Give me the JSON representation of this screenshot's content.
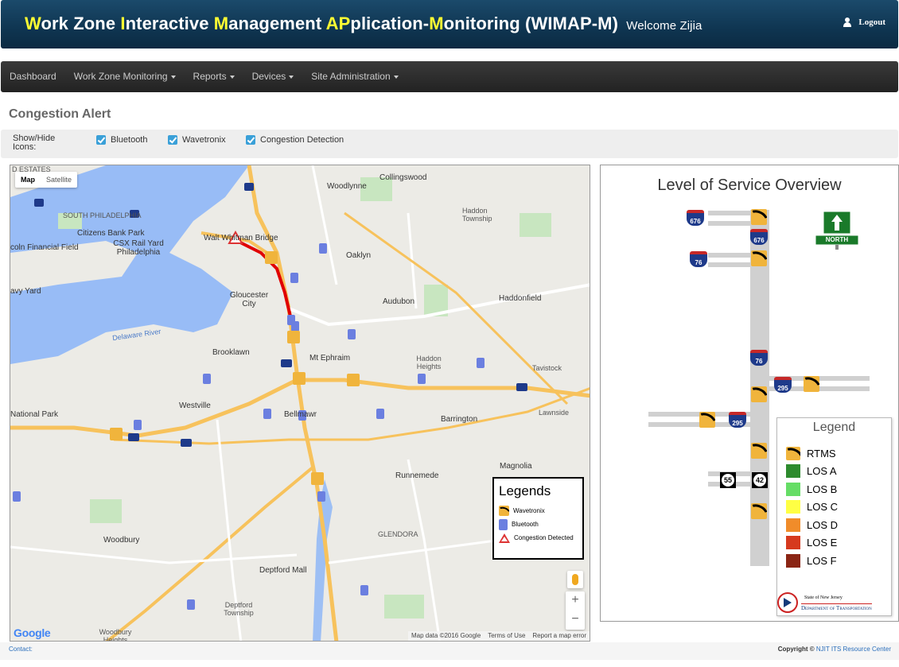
{
  "header": {
    "title_parts": [
      {
        "text": "W",
        "hl": true
      },
      {
        "text": "ork Zone ",
        "hl": false
      },
      {
        "text": "I",
        "hl": true
      },
      {
        "text": "nteractive ",
        "hl": false
      },
      {
        "text": "M",
        "hl": true
      },
      {
        "text": "anagement ",
        "hl": false
      },
      {
        "text": "AP",
        "hl": true
      },
      {
        "text": "plication-",
        "hl": false
      },
      {
        "text": "M",
        "hl": true
      },
      {
        "text": "onitoring (WIMAP-M)",
        "hl": false
      }
    ],
    "welcome": "Welcome Zijia",
    "logout_label": "Logout"
  },
  "nav": {
    "items": [
      {
        "label": "Dashboard",
        "dropdown": false
      },
      {
        "label": "Work Zone Monitoring",
        "dropdown": true
      },
      {
        "label": "Reports",
        "dropdown": true
      },
      {
        "label": "Devices",
        "dropdown": true
      },
      {
        "label": "Site Administration",
        "dropdown": true
      }
    ]
  },
  "page": {
    "title": "Congestion Alert",
    "show_hide_label": "Show/Hide Icons:",
    "checkboxes": [
      {
        "label": "Bluetooth",
        "checked": true
      },
      {
        "label": "Wavetronix",
        "checked": true
      },
      {
        "label": "Congestion Detection",
        "checked": true
      }
    ]
  },
  "map": {
    "type_buttons": {
      "map": "Map",
      "satellite": "Satellite"
    },
    "labels": [
      "D ESTATES",
      "Collingswood",
      "Woodlynne",
      "Haddon Township",
      "SOUTH PHILADELPHIA",
      "Citizens Bank Park",
      "CSX Rail Yard Philadelphia",
      "Walt Whitman Bridge",
      "coln Financial Field",
      "Oaklyn",
      "Gloucester City",
      "Audubon",
      "Haddonfield",
      "avy Yard",
      "Delaware River",
      "Brooklawn",
      "Mt Ephraim",
      "Haddon Heights",
      "Tavistock",
      "Westville",
      "Bellmawr",
      "Barrington",
      "Lawnside",
      "National Park",
      "Magnolia",
      "Runnemede",
      "GLENDORA",
      "Woodbury",
      "Deptford Mall",
      "Deptford Township",
      "Woodbury Heights"
    ],
    "legend": {
      "title": "Legends",
      "items": [
        "Wavetronix",
        "Bluetooth",
        "Congestion Detected"
      ]
    },
    "google": "Google",
    "footer": [
      "Map data ©2016 Google",
      "Terms of Use",
      "Report a map error"
    ]
  },
  "los": {
    "title": "Level of Service Overview",
    "north_label": "NORTH",
    "shields": [
      "676",
      "676",
      "76",
      "76",
      "295",
      "295"
    ],
    "state_routes": [
      "55",
      "42"
    ],
    "legend_title": "Legend",
    "legend_items": [
      {
        "label": "RTMS",
        "color": null
      },
      {
        "label": "LOS A",
        "color": "#2e8b2e"
      },
      {
        "label": "LOS B",
        "color": "#66dd66"
      },
      {
        "label": "LOS C",
        "color": "#ffff44"
      },
      {
        "label": "LOS D",
        "color": "#f08c2a"
      },
      {
        "label": "LOS E",
        "color": "#d63a1e"
      },
      {
        "label": "LOS F",
        "color": "#8b2514"
      }
    ],
    "dot_line1": "State of New Jersey",
    "dot_line2": "Department of Transportation"
  },
  "footer": {
    "contact": "Contact:",
    "copyright_prefix": "Copyright ©",
    "copyright_link": "NJIT ITS Resource Center"
  }
}
